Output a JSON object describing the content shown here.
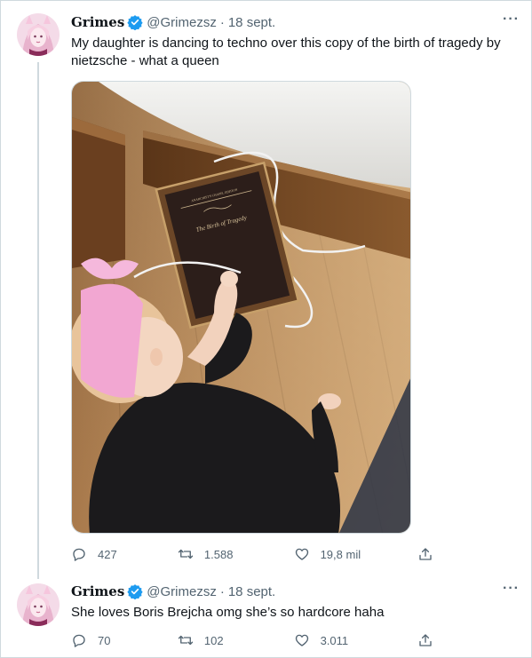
{
  "tweets": [
    {
      "author": {
        "name": "Grimes",
        "handle": "@Grimezsz"
      },
      "date": "18 sept.",
      "text_line1": "My daughter is dancing to techno over this copy of the birth of tragedy by",
      "text_line2": "nietzsche - what a queen",
      "media": {
        "book_publisher": "ANARCHIST'S CHAPEL EDITION",
        "book_title": "The Birth of Tragedy"
      },
      "stats": {
        "replies": "427",
        "retweets": "1.588",
        "likes": "19,8 mil"
      }
    },
    {
      "author": {
        "name": "Grimes",
        "handle": "@Grimezsz"
      },
      "date": "18 sept.",
      "text": "She loves Boris Brejcha omg she’s so hardcore haha",
      "stats": {
        "replies": "70",
        "retweets": "102",
        "likes": "3.011"
      }
    }
  ],
  "icons": {
    "more": "more-icon",
    "verified": "verified-badge-icon",
    "reply": "reply-icon",
    "retweet": "retweet-icon",
    "like": "like-icon",
    "share": "share-icon"
  },
  "colors": {
    "verified": "#1d9bf0",
    "secondary_text": "#536471",
    "border": "#cfd9de"
  }
}
